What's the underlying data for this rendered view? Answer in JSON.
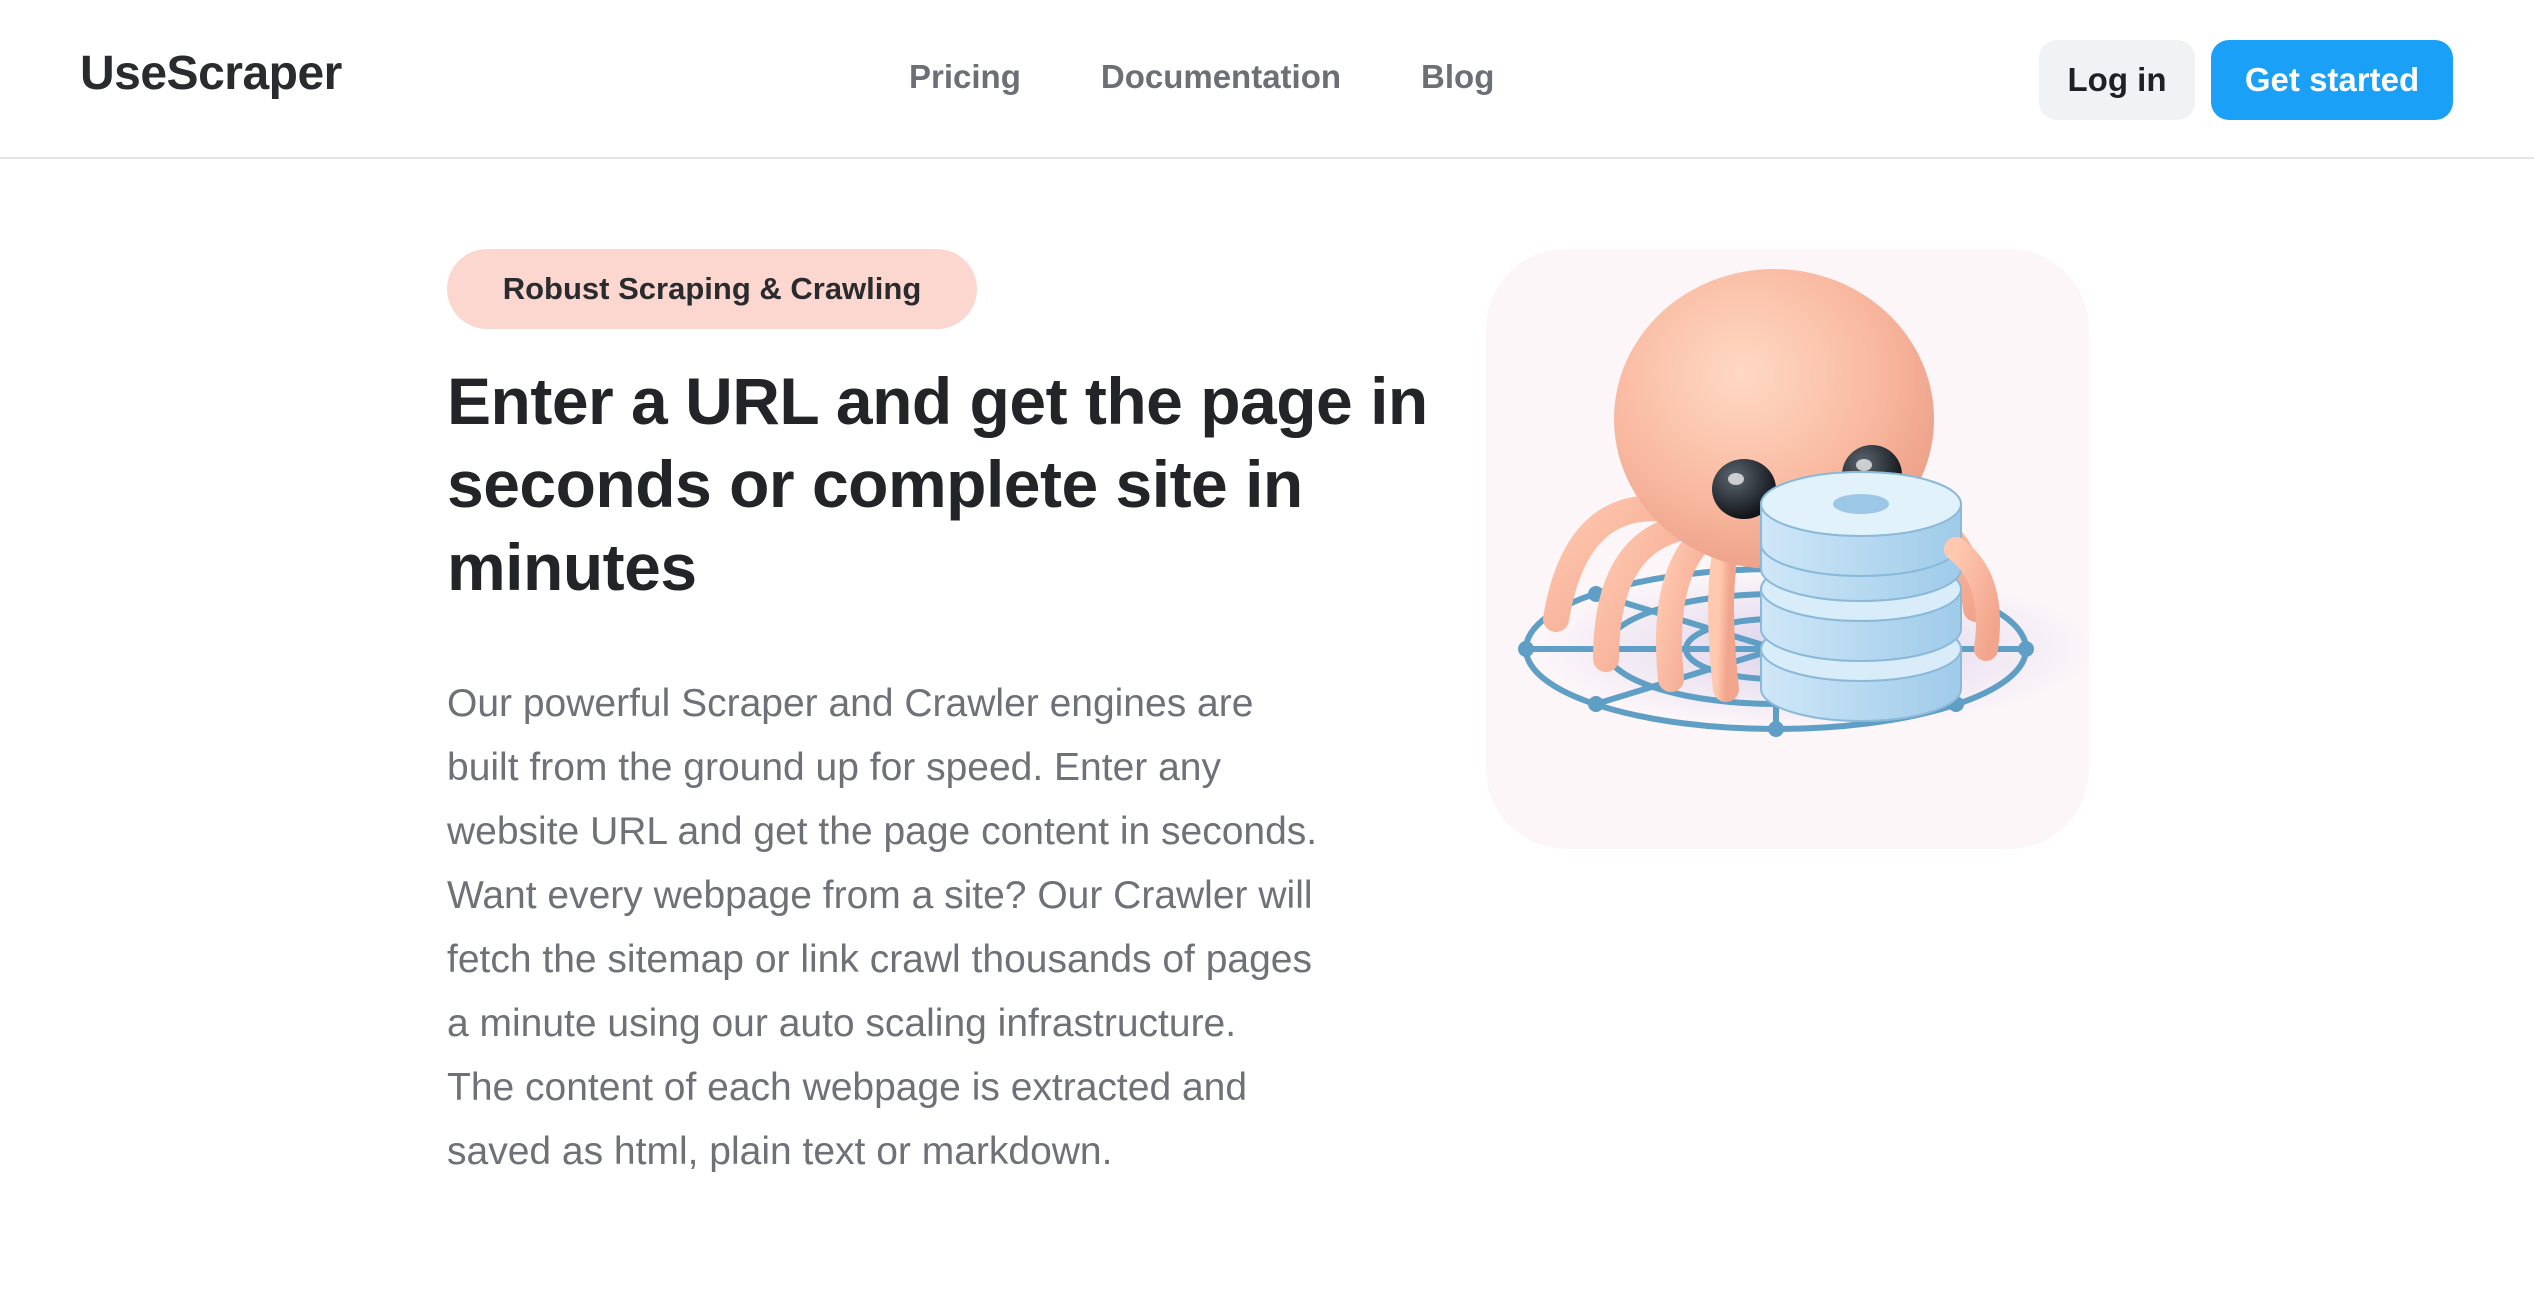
{
  "header": {
    "logo": "UseScraper",
    "nav": [
      {
        "label": "Pricing"
      },
      {
        "label": "Documentation"
      },
      {
        "label": "Blog"
      }
    ],
    "login_label": "Log in",
    "get_started_label": "Get started"
  },
  "hero": {
    "badge": "Robust Scraping & Crawling",
    "headline_lines": [
      "Enter a URL and get the page in",
      "seconds or complete site in",
      "minutes"
    ],
    "description_lines": [
      "Our powerful Scraper and Crawler engines are",
      "built from the ground up for speed. Enter any",
      "website URL and get the page content in seconds.",
      "Want every webpage from a site? Our Crawler will",
      "fetch the sitemap or link crawl thousands of pages",
      "a minute using our auto scaling infrastructure.",
      "The content of each webpage is extracted and",
      "saved as html, plain text or markdown."
    ],
    "illustration": "spider-mascot-with-database-on-web"
  },
  "colors": {
    "accent": "#1aa1f7",
    "badge_bg": "#fbd7d0",
    "text_primary": "#232428",
    "text_muted": "#6f7179"
  }
}
